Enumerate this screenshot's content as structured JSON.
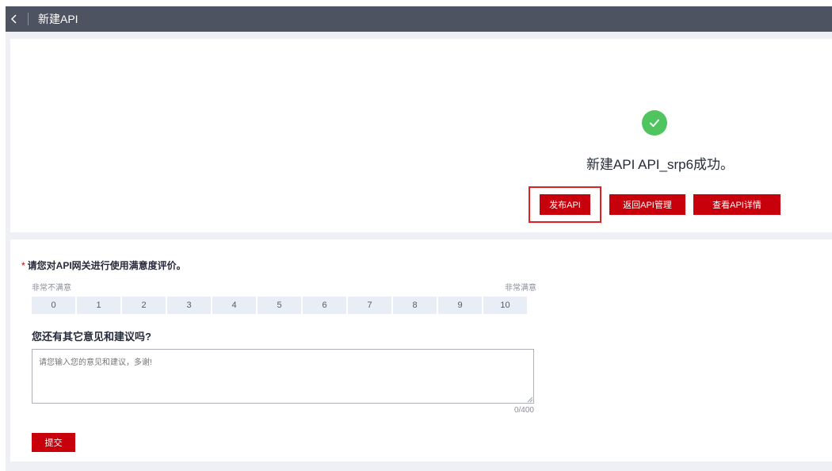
{
  "header": {
    "title": "新建API"
  },
  "success": {
    "message": "新建API API_srp6成功。",
    "buttons": {
      "publish": "发布API",
      "return": "返回API管理",
      "detail": "查看API详情"
    }
  },
  "survey": {
    "required_mark": "*",
    "question1": "请您对API网关进行使用满意度评价。",
    "scale_low": "非常不满意",
    "scale_high": "非常满意",
    "ratings": [
      "0",
      "1",
      "2",
      "3",
      "4",
      "5",
      "6",
      "7",
      "8",
      "9",
      "10"
    ],
    "question2": "您还有其它意见和建议吗?",
    "feedback_placeholder": "请您输入您的意见和建议，多谢!",
    "counter": "0/400",
    "submit": "提交"
  },
  "colors": {
    "topbar": "#4d5361",
    "primary": "#c7000b",
    "success": "#50c45e",
    "highlight": "#e02020"
  }
}
